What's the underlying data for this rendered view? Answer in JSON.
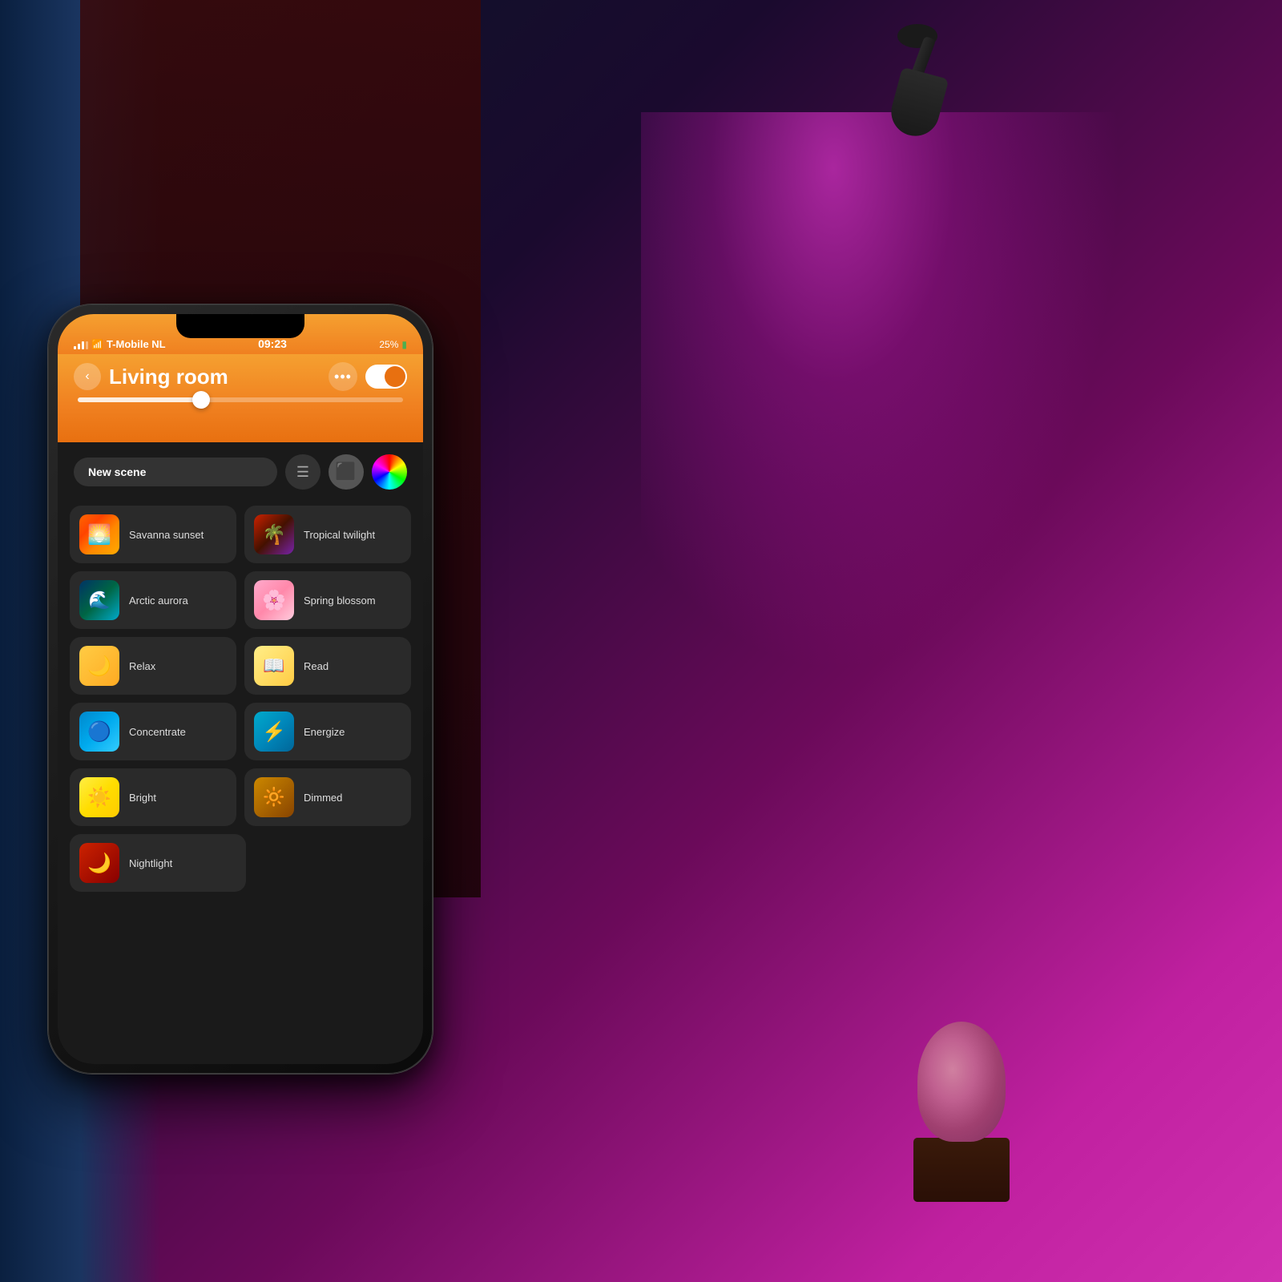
{
  "background": {
    "gradient_desc": "dark purple to magenta room with smart lighting"
  },
  "phone": {
    "status_bar": {
      "carrier": "T-Mobile NL",
      "wifi_symbol": "wifi",
      "time": "09:23",
      "battery_percent": "25%"
    },
    "header": {
      "back_label": "‹",
      "title": "Living room",
      "more_label": "•••",
      "toggle_state": "on"
    },
    "brightness_slider": {
      "value": 40
    },
    "toolbar": {
      "new_scene_label": "New scene",
      "list_icon": "☰",
      "scenes_icon": "⬤",
      "color_icon": "◉"
    },
    "scenes": [
      {
        "id": "savanna-sunset",
        "label": "Savanna sunset",
        "thumb": "thumb-savanna"
      },
      {
        "id": "tropical-twilight",
        "label": "Tropical twilight",
        "thumb": "thumb-tropical"
      },
      {
        "id": "arctic-aurora",
        "label": "Arctic aurora",
        "thumb": "thumb-arctic"
      },
      {
        "id": "spring-blossom",
        "label": "Spring blossom",
        "thumb": "thumb-spring"
      },
      {
        "id": "relax",
        "label": "Relax",
        "thumb": "thumb-relax"
      },
      {
        "id": "read",
        "label": "Read",
        "thumb": "thumb-read"
      },
      {
        "id": "concentrate",
        "label": "Concentrate",
        "thumb": "thumb-concentrate"
      },
      {
        "id": "energize",
        "label": "Energize",
        "thumb": "thumb-energize"
      },
      {
        "id": "bright",
        "label": "Bright",
        "thumb": "thumb-bright"
      },
      {
        "id": "dimmed",
        "label": "Dimmed",
        "thumb": "thumb-dimmed"
      },
      {
        "id": "nightlight",
        "label": "Nightlight",
        "thumb": "thumb-nightlight"
      }
    ]
  },
  "colors": {
    "header_gradient_start": "#f5a030",
    "header_gradient_end": "#e87010",
    "app_bg": "#1a1a1a",
    "scene_item_bg": "#2a2a2a"
  }
}
